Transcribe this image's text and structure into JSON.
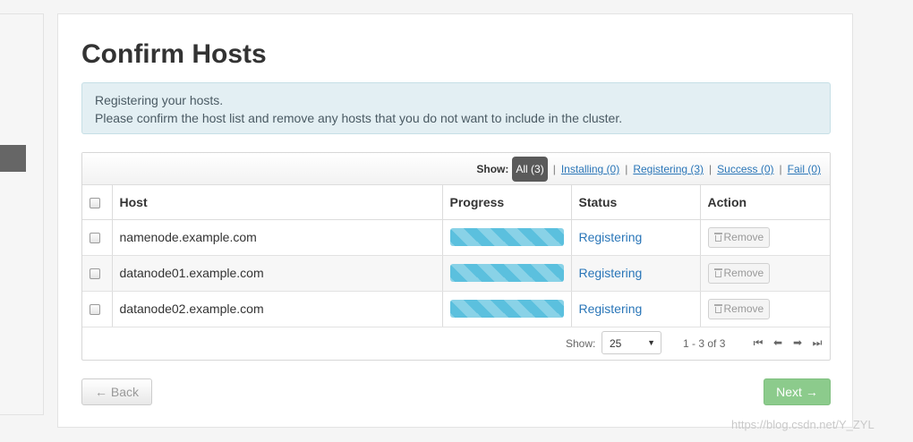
{
  "page": {
    "title": "Confirm Hosts",
    "alert_line1": "Registering your hosts.",
    "alert_line2": "Please confirm the host list and remove any hosts that you do not want to include in the cluster."
  },
  "filter": {
    "show_label": "Show:",
    "all": "All (3)",
    "installing": "Installing (0)",
    "registering": "Registering (3)",
    "success": "Success (0)",
    "fail": "Fail (0)",
    "separator": "|"
  },
  "table": {
    "headers": {
      "host": "Host",
      "progress": "Progress",
      "status": "Status",
      "action": "Action"
    },
    "rows": [
      {
        "host": "namenode.example.com",
        "progress": 1.0,
        "status": "Registering",
        "action": "Remove"
      },
      {
        "host": "datanode01.example.com",
        "progress": 1.0,
        "status": "Registering",
        "action": "Remove"
      },
      {
        "host": "datanode02.example.com",
        "progress": 1.0,
        "status": "Registering",
        "action": "Remove"
      }
    ]
  },
  "pagination": {
    "show_label": "Show:",
    "page_size": "25",
    "range": "1 - 3 of 3",
    "icons": [
      "first-page-icon",
      "prev-page-icon",
      "next-page-icon",
      "last-page-icon"
    ]
  },
  "buttons": {
    "back": "← Back",
    "next": "Next →"
  },
  "watermark": "https://blog.csdn.net/Y_ZYL",
  "colors": {
    "progress": "#5bc0de",
    "link": "#2a76b8",
    "next_button": "#8ccb8c",
    "active_filter": "#5a5a5a"
  }
}
